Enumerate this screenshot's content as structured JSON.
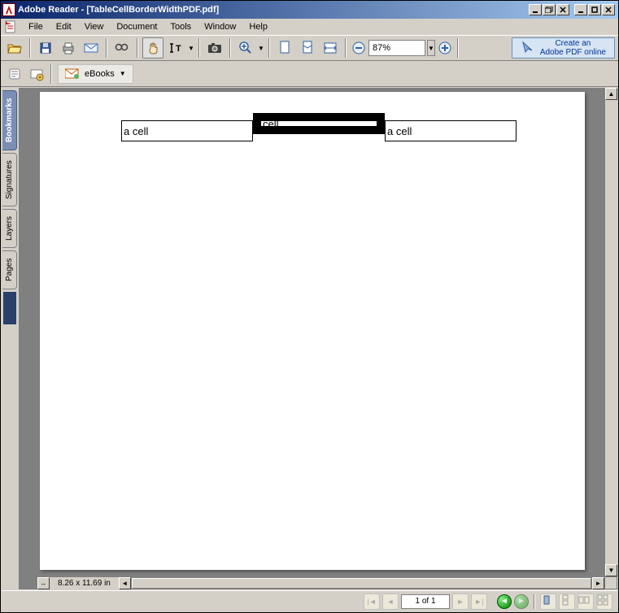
{
  "window": {
    "title": "Adobe Reader - [TableCellBorderWidthPDF.pdf]",
    "app_icon_letter": "A"
  },
  "menu": {
    "file": "File",
    "edit": "Edit",
    "view": "View",
    "document": "Document",
    "tools": "Tools",
    "window": "Window",
    "help": "Help"
  },
  "toolbar": {
    "zoom_value": "87%",
    "adobe_link_line1": "Create an",
    "adobe_link_line2": "Adobe PDF online"
  },
  "toolbar2": {
    "ebooks_label": "eBooks"
  },
  "side_tabs": {
    "bookmarks": "Bookmarks",
    "signatures": "Signatures",
    "layers": "Layers",
    "pages": "Pages"
  },
  "page": {
    "cell1": "a cell",
    "cell2": "cell",
    "cell3": "a cell"
  },
  "status": {
    "page_dimensions": "8.26 x 11.69 in",
    "page_indicator": "1 of 1"
  }
}
